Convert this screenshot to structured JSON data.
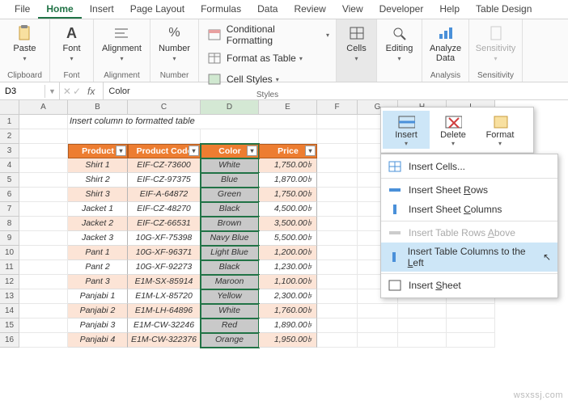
{
  "tabs": [
    "File",
    "Home",
    "Insert",
    "Page Layout",
    "Formulas",
    "Data",
    "Review",
    "View",
    "Developer",
    "Help",
    "Table Design"
  ],
  "active_tab": "Home",
  "ribbon": {
    "clipboard": {
      "paste": "Paste",
      "label": "Clipboard"
    },
    "font": {
      "btn": "Font",
      "label": "Font"
    },
    "alignment": {
      "btn": "Alignment",
      "label": "Alignment"
    },
    "number": {
      "btn": "Number",
      "label": "Number"
    },
    "styles": {
      "cond": "Conditional Formatting",
      "table": "Format as Table",
      "cell": "Cell Styles",
      "label": "Styles"
    },
    "cells": {
      "btn": "Cells"
    },
    "editing": {
      "btn": "Editing"
    },
    "analysis": {
      "btn": "Analyze Data",
      "label": "Analysis"
    },
    "sensitivity": {
      "btn": "Sensitivity",
      "label": "Sensitivity"
    }
  },
  "namebox": "D3",
  "formula": "Color",
  "col_headers": [
    "A",
    "B",
    "C",
    "D",
    "E",
    "F",
    "G",
    "H",
    "I"
  ],
  "row_headers": [
    "1",
    "2",
    "3",
    "4",
    "5",
    "6",
    "7",
    "8",
    "9",
    "10",
    "11",
    "12",
    "13",
    "14",
    "15",
    "16"
  ],
  "table_title": "Insert column to formatted table",
  "headers": [
    "Product",
    "Product Code",
    "Color",
    "Price"
  ],
  "rows": [
    [
      "Shirt 1",
      "EIF-CZ-73600",
      "White",
      "1,750.00৳"
    ],
    [
      "Shirt 2",
      "EIF-CZ-97375",
      "Blue",
      "1,870.00৳"
    ],
    [
      "Shirt 3",
      "EIF-A-64872",
      "Green",
      "1,750.00৳"
    ],
    [
      "Jacket 1",
      "EIF-CZ-48270",
      "Black",
      "4,500.00৳"
    ],
    [
      "Jacket 2",
      "EIF-CZ-66531",
      "Brown",
      "3,500.00৳"
    ],
    [
      "Jacket 3",
      "10G-XF-75398",
      "Navy Blue",
      "5,500.00৳"
    ],
    [
      "Pant 1",
      "10G-XF-96371",
      "Light Blue",
      "1,200.00৳"
    ],
    [
      "Pant 2",
      "10G-XF-92273",
      "Black",
      "1,230.00৳"
    ],
    [
      "Pant 3",
      "E1M-SX-85914",
      "Maroon",
      "1,100.00৳"
    ],
    [
      "Panjabi 1",
      "E1M-LX-85720",
      "Yellow",
      "2,300.00৳"
    ],
    [
      "Panjabi 2",
      "E1M-LH-64896",
      "White",
      "1,760.00৳"
    ],
    [
      "Panjabi 3",
      "E1M-CW-32246",
      "Red",
      "1,890.00৳"
    ],
    [
      "Panjabi 4",
      "E1M-CW-322376",
      "Orange",
      "1,950.00৳"
    ]
  ],
  "cells_menu": {
    "insert": "Insert",
    "delete": "Delete",
    "format": "Format"
  },
  "context_menu": {
    "insert_cells": "Insert Cells...",
    "sheet_rows": "Insert Sheet Rows",
    "sheet_cols": "Insert Sheet Columns",
    "table_rows": "Insert Table Rows Above",
    "table_cols": "Insert Table Columns to the Left",
    "insert_sheet": "Insert Sheet"
  },
  "watermark": "wsxssj.com"
}
